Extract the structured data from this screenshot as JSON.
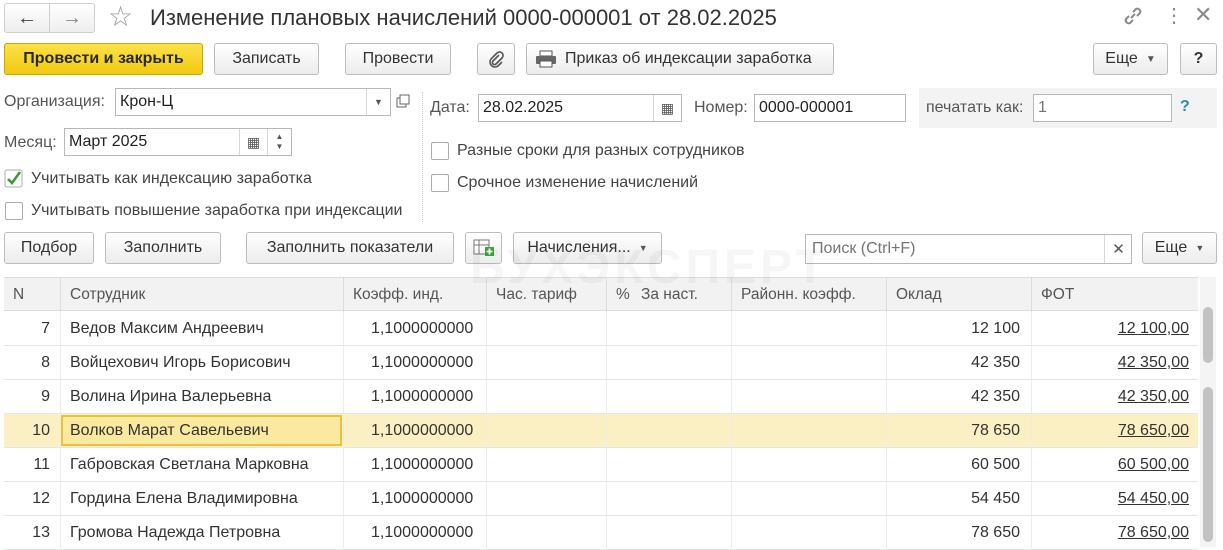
{
  "window": {
    "title": "Изменение плановых начислений 0000-000001 от 28.02.2025"
  },
  "toolbar": {
    "post_close_label": "Провести и закрыть",
    "save_label": "Записать",
    "post_label": "Провести",
    "print_order_label": "Приказ об индексации заработка",
    "more_label": "Еще",
    "help_label": "?"
  },
  "form": {
    "org_label": "Организация:",
    "org_value": "Крон-Ц",
    "month_label": "Месяц:",
    "month_value": "Март 2025",
    "date_label": "Дата:",
    "date_value": "28.02.2025",
    "number_label": "Номер:",
    "number_value": "0000-000001",
    "print_as_label": "печатать как:",
    "print_as_placeholder": "1",
    "print_as_help": "?",
    "chk_indexation": {
      "label": "Учитывать как индексацию заработка",
      "checked": true
    },
    "chk_raise": {
      "label": "Учитывать повышение заработка при индексации",
      "checked": false
    },
    "chk_diff_terms": {
      "label": "Разные сроки для разных сотрудников",
      "checked": false
    },
    "chk_urgent": {
      "label": "Срочное изменение начислений",
      "checked": false
    }
  },
  "table_toolbar": {
    "select_label": "Подбор",
    "fill_label": "Заполнить",
    "fill_indicators_label": "Заполнить показатели",
    "accruals_label": "Начисления...",
    "search_placeholder": "Поиск (Ctrl+F)",
    "more_label": "Еще"
  },
  "watermark": "БУХЭКСПЕРТ",
  "table": {
    "columns": [
      "N",
      "Сотрудник",
      "Коэфф. инд.",
      "Час. тариф",
      "%",
      "За наст.",
      "Районн. коэфф.",
      "Оклад",
      "ФОТ"
    ],
    "rows": [
      {
        "n": "7",
        "employee": "Ведов Максим Андреевич",
        "coef": "1,1000000000",
        "salary": "12 100",
        "fot": "12 100,00"
      },
      {
        "n": "8",
        "employee": "Войцехович Игорь Борисович",
        "coef": "1,1000000000",
        "salary": "42 350",
        "fot": "42 350,00"
      },
      {
        "n": "9",
        "employee": "Волина Ирина Валерьевна",
        "coef": "1,1000000000",
        "salary": "42 350",
        "fot": "42 350,00"
      },
      {
        "n": "10",
        "employee": "Волков Марат Савельевич",
        "coef": "1,1000000000",
        "salary": "78 650",
        "fot": "78 650,00"
      },
      {
        "n": "11",
        "employee": "Габровская Светлана Марковна",
        "coef": "1,1000000000",
        "salary": "60 500",
        "fot": "60 500,00"
      },
      {
        "n": "12",
        "employee": "Гордина Елена Владимировна",
        "coef": "1,1000000000",
        "salary": "54 450",
        "fot": "54 450,00"
      },
      {
        "n": "13",
        "employee": "Громова Надежда Петровна",
        "coef": "1,1000000000",
        "salary": "78 650",
        "fot": "78 650,00"
      }
    ],
    "selected_row": "10"
  },
  "colors": {
    "primary_button": "#f5d21d",
    "selected_row": "#fbf0c4",
    "selected_cell_border": "#e7c23a",
    "check_mark": "#3a9a3a",
    "help_link": "#2e86c1"
  }
}
